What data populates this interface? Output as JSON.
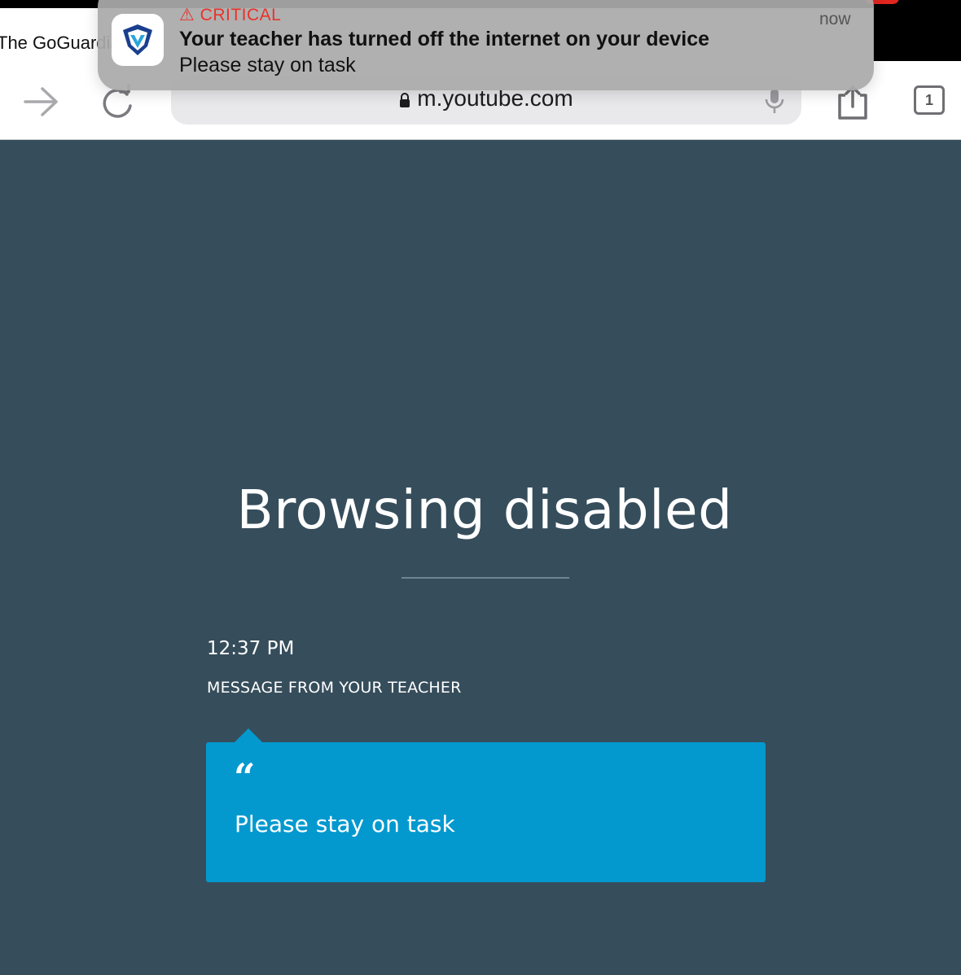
{
  "browser": {
    "tab_title": "The GoGuardian",
    "url": "m.youtube.com",
    "tab_count": "1"
  },
  "notification": {
    "severity_label": "CRITICAL",
    "title": "Your teacher has turned off the internet on your device",
    "body": "Please stay on task",
    "time": "now",
    "app_icon": "goguardian-shield-icon"
  },
  "page": {
    "heading": "Browsing disabled",
    "timestamp": "12:37 PM",
    "message_label": "MESSAGE FROM YOUR TEACHER",
    "quote_mark": "“",
    "message": "Please stay on task"
  },
  "colors": {
    "page_background": "#364d5b",
    "message_box": "#0399cf",
    "critical_red": "#e8322a"
  }
}
